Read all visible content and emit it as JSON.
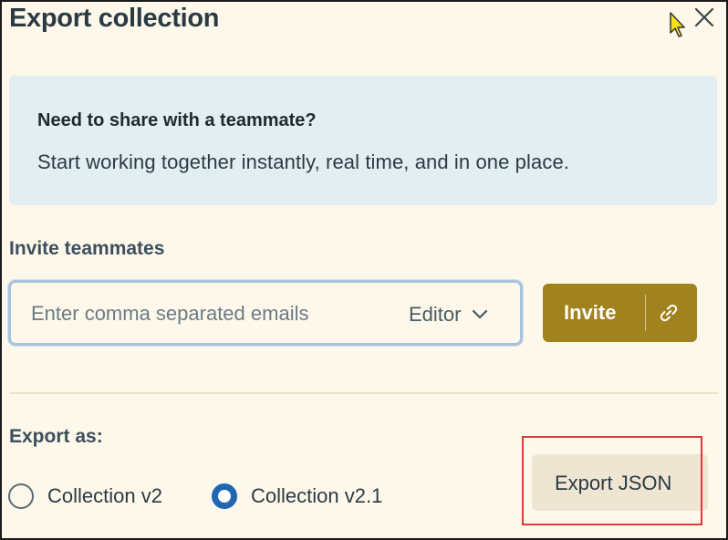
{
  "dialog": {
    "title": "Export collection",
    "close_icon": "close-icon"
  },
  "share_banner": {
    "heading": "Need to share with a teammate?",
    "body": "Start working together instantly, real time, and in one place."
  },
  "invite": {
    "label": "Invite teammates",
    "email_placeholder": "Enter comma separated emails",
    "email_value": "",
    "role_value": "Editor",
    "role_icon": "chevron-down-icon",
    "button_label": "Invite",
    "link_icon": "link-icon"
  },
  "export": {
    "label": "Export as:",
    "options": [
      {
        "label": "Collection v2",
        "selected": false
      },
      {
        "label": "Collection v2.1",
        "selected": true
      }
    ],
    "button_label": "Export JSON"
  },
  "colors": {
    "background": "#fdf8ea",
    "banner": "#e2eef2",
    "invite_button": "#a0821f",
    "radio_selected": "#1f67b1",
    "highlight": "#e03a3a"
  }
}
